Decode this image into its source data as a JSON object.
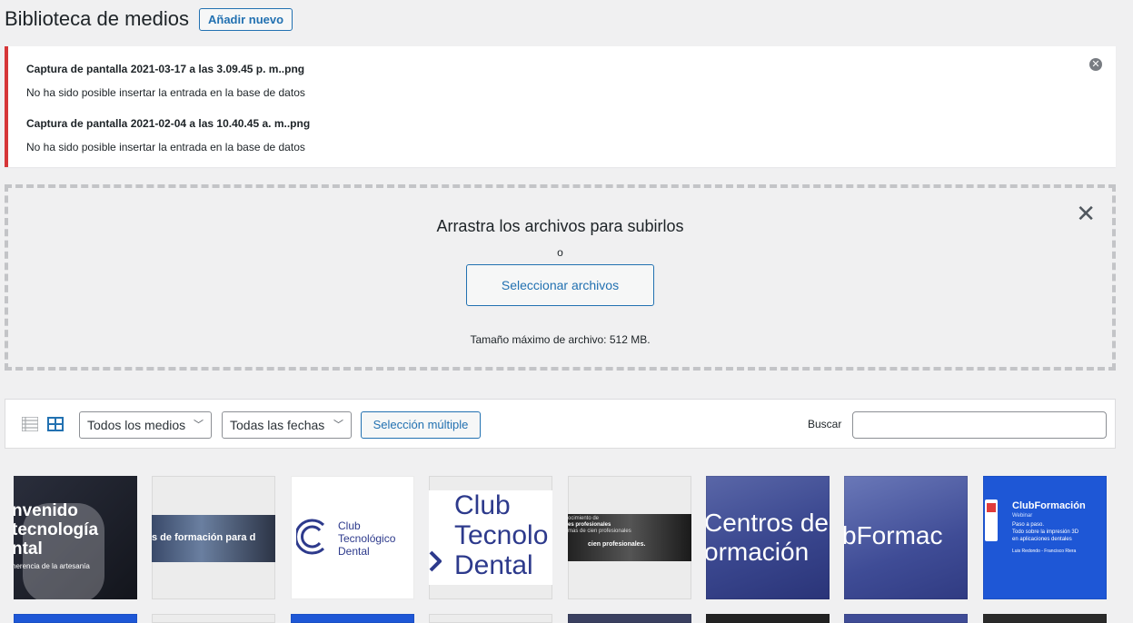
{
  "header": {
    "title": "Biblioteca de medios",
    "add_new_label": "Añadir nuevo"
  },
  "notice": {
    "errors": [
      {
        "filename": "Captura de pantalla 2021-03-17 a las 3.09.45 p. m..png",
        "message": "No ha sido posible insertar la entrada en la base de datos"
      },
      {
        "filename": "Captura de pantalla 2021-02-04 a las 10.40.45 a. m..png",
        "message": "No ha sido posible insertar la entrada en la base de datos"
      }
    ],
    "dismiss_icon": "close-circle-icon",
    "border_color": "#d63638"
  },
  "uploader": {
    "drop_text": "Arrastra los archivos para subirlos",
    "or_text": "o",
    "select_button": "Seleccionar archivos",
    "max_size": "Tamaño máximo de archivo: 512 MB.",
    "close_icon": "close-icon"
  },
  "toolbar": {
    "media_filter": "Todos los medios",
    "date_filter": "Todas las fechas",
    "bulk_select": "Selección múltiple",
    "search_label": "Buscar",
    "search_value": ""
  },
  "thumbnails": [
    {
      "name": "thumb-bienvenido",
      "lines": [
        "nvenido",
        "tecnología",
        "ntal",
        "herencia de la artesanía"
      ]
    },
    {
      "name": "thumb-formacion-banner",
      "lines": [
        "s de formación para d"
      ]
    },
    {
      "name": "thumb-club-logo-small",
      "lines": [
        "Club",
        "Tecnológico",
        "Dental"
      ]
    },
    {
      "name": "thumb-club-logo-large",
      "lines": [
        "Club",
        "Tecnolo",
        "Dental"
      ]
    },
    {
      "name": "thumb-profesionales",
      "lines": [
        "ocimiento de",
        "es profesionales",
        "mas de cien profesionales",
        "cien profesionales."
      ]
    },
    {
      "name": "thumb-centros-formacion",
      "lines": [
        "Centros de",
        "ormación"
      ]
    },
    {
      "name": "thumb-clubformacion",
      "lines": [
        "bFormac"
      ]
    },
    {
      "name": "thumb-webinar",
      "lines": [
        "ClubFormación",
        "Webinar",
        "Paso a paso.",
        "Todo sobre la impresión 3D",
        "en aplicaciones dentales",
        "Luis Redondo - Francisco Riera"
      ]
    }
  ],
  "colors": {
    "accent": "#2271b1",
    "background": "#f0f0f1",
    "brand_blue": "#1e57d6"
  }
}
